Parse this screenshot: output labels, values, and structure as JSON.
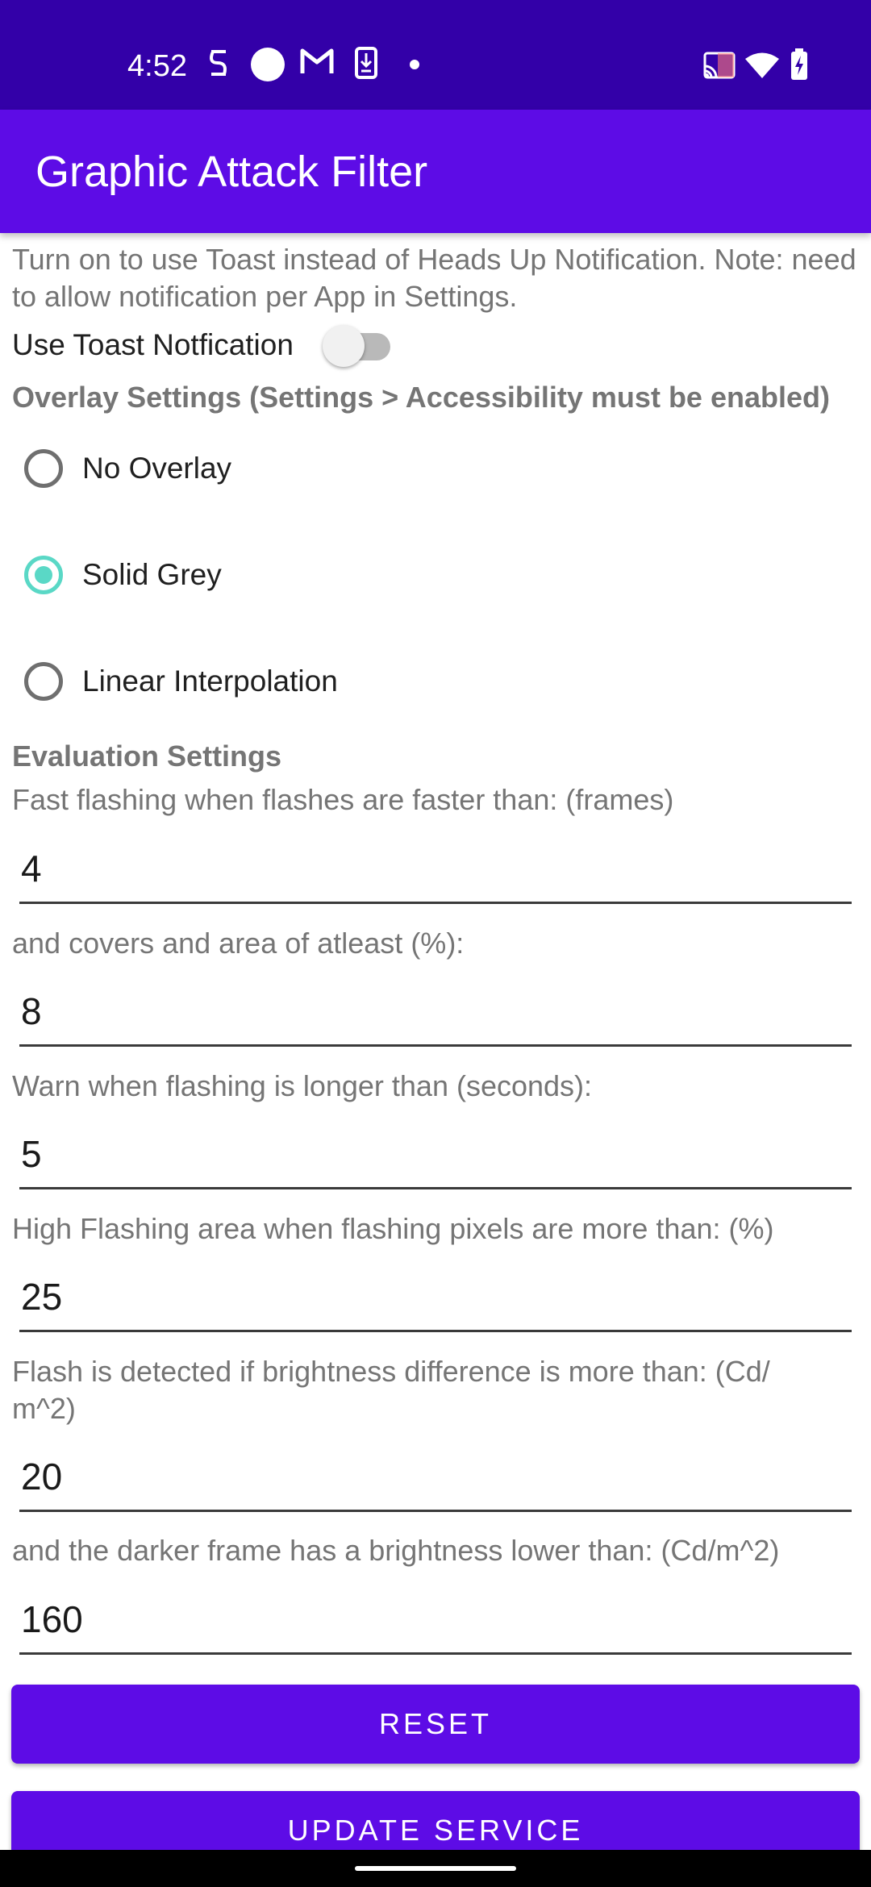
{
  "status_bar": {
    "time": "4:52",
    "left_icons": [
      "sync-icon",
      "circle-icon",
      "gmail-icon",
      "download-icon",
      "dot-icon"
    ],
    "right_icons": [
      "cast-icon",
      "wifi-icon",
      "battery-charging-icon"
    ]
  },
  "app_bar": {
    "title": "Graphic Attack Filter"
  },
  "toast": {
    "description": "Turn on to use Toast instead of Heads Up Notification. Note: need to allow notification per App in Settings.",
    "toggle_label": "Use Toast Notfication",
    "toggle_on": false
  },
  "overlay": {
    "heading": "Overlay Settings (Settings > Accessibility must be enabled)",
    "options": [
      {
        "label": "No Overlay",
        "checked": false
      },
      {
        "label": "Solid Grey",
        "checked": true
      },
      {
        "label": "Linear Interpolation",
        "checked": false
      }
    ]
  },
  "evaluation": {
    "heading": "Evaluation Settings",
    "fields": [
      {
        "label": "Fast flashing when flashes are faster than: (frames)",
        "value": "4"
      },
      {
        "label": "and covers and area of atleast (%):",
        "value": "8"
      },
      {
        "label": "Warn when flashing is longer than (seconds):",
        "value": "5"
      },
      {
        "label": "High Flashing area when flashing pixels are more than: (%)",
        "value": "25"
      },
      {
        "label": "Flash is detected if brightness difference is more than: (Cd/\nm^2)",
        "value": "20"
      },
      {
        "label": "and the darker frame has a brightness lower than: (Cd/m^2)",
        "value": "160"
      }
    ]
  },
  "buttons": {
    "reset": "RESET",
    "update": "UPDATE SERVICE"
  },
  "colors": {
    "status_bar": "#3300a8",
    "app_bar": "#5d0ce6",
    "button": "#5d0ce6",
    "radio_checked": "#5ad8c6"
  }
}
